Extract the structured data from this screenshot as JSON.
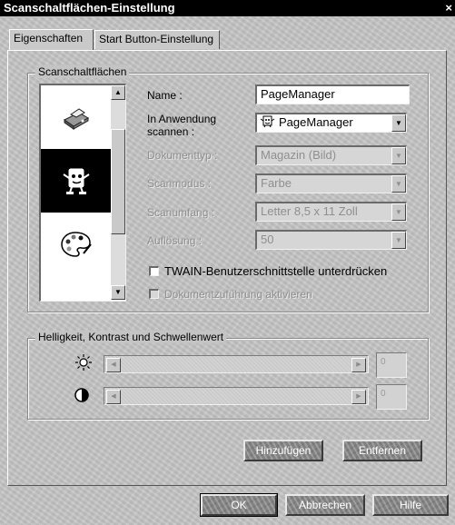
{
  "window": {
    "title": "Scanschaltflächen-Einstellung",
    "close_symbol": "×"
  },
  "tabs": [
    {
      "label": "Eigenschaften",
      "active": true
    },
    {
      "label": "Start Button-Einstellung",
      "active": false
    }
  ],
  "scan_buttons_group": {
    "title": "Scanschaltflächen",
    "list_icons": [
      "printer-scanner-icon",
      "pagemanager-mascot-icon",
      "paint-palette-icon"
    ],
    "selected_index": 1,
    "fields": {
      "name": {
        "label": "Name :",
        "value": "PageManager"
      },
      "application": {
        "label_line1": "In Anwendung",
        "label_line2": "scannen :",
        "value": "PageManager"
      },
      "document_type": {
        "label": "Dokumenttyp :",
        "value": "Magazin (Bild)"
      },
      "scan_mode": {
        "label": "Scanmodus :",
        "value": "Farbe"
      },
      "scan_area": {
        "label": "Scanumfang :",
        "value": "Letter 8,5 x 11 Zoll"
      },
      "resolution": {
        "label": "Auflösung :",
        "value": "50"
      }
    },
    "twain_checkbox": {
      "label": "TWAIN-Benutzerschnittstelle unterdrücken",
      "checked": false
    },
    "feeder_checkbox": {
      "label": "Dokumentzuführung aktivieren",
      "checked": false,
      "disabled": true
    }
  },
  "adjust_group": {
    "title": "Helligkeit, Kontrast und Schwellenwert",
    "brightness": {
      "icon": "sun-icon",
      "value": "0",
      "level": 0
    },
    "contrast": {
      "icon": "contrast-icon",
      "value": "0",
      "level": 0
    }
  },
  "action_buttons": {
    "add": "Hinzufügen",
    "remove": "Entfernen"
  },
  "dialog_buttons": {
    "ok": "OK",
    "cancel": "Abbrechen",
    "help": "Hilfe"
  }
}
